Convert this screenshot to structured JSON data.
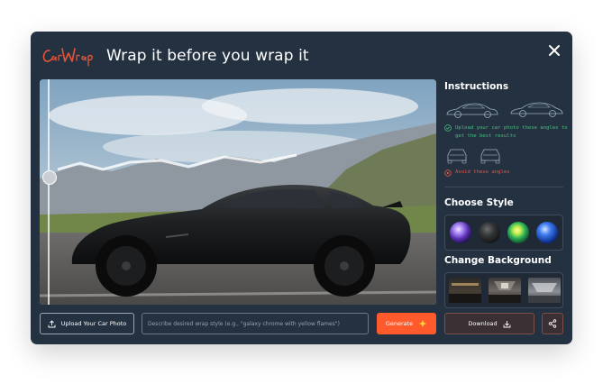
{
  "brand": {
    "logo_text": "CarWrap"
  },
  "header": {
    "title": "Wrap it before you wrap it",
    "close_icon": "close-icon"
  },
  "instructions": {
    "heading": "Instructions",
    "good_text": "Upload your car photo these angles to get the best results",
    "bad_text": "Avoid these angles"
  },
  "style": {
    "heading": "Choose Style",
    "options": [
      "purple-chrome",
      "matte-black",
      "green-chrome",
      "blue-gloss"
    ]
  },
  "background": {
    "heading": "Change Background",
    "options": [
      "garage-dark",
      "showroom-tunnel",
      "studio-white"
    ]
  },
  "bottom": {
    "upload_label": "Upload Your Car Photo",
    "prompt_placeholder": "Describe desired wrap style (e.g., \"galaxy chrome with yellow flames\")",
    "generate_label": "Generate",
    "download_label": "Download"
  },
  "colors": {
    "accent": "#ff5a2b",
    "panel": "#243140",
    "ok": "#47c07d",
    "bad": "#e0574a"
  }
}
